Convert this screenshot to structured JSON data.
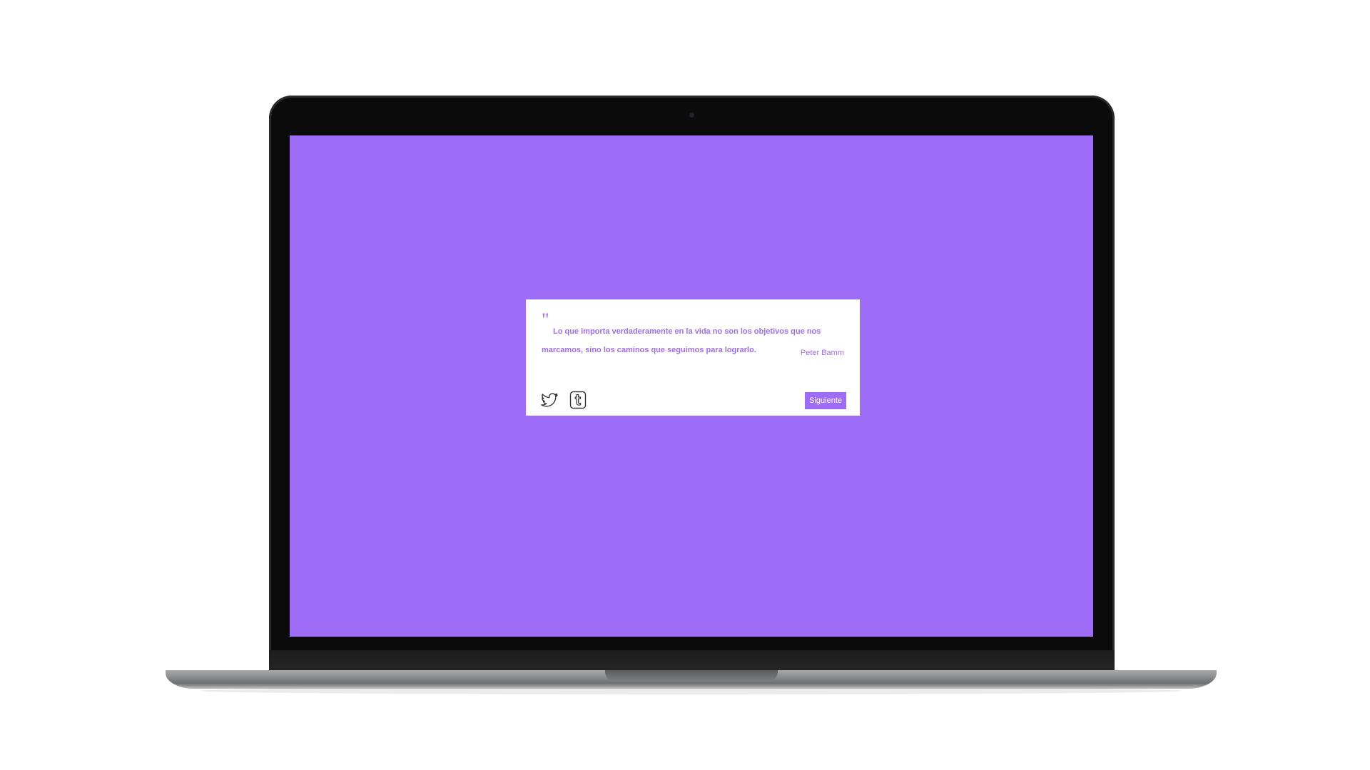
{
  "colors": {
    "accent": "#9f6cf8",
    "card_background": "#ffffff"
  },
  "quote": {
    "mark": "\"",
    "text": "Lo que importa verdaderamente en la vida no son los objetivos que nos marcamos, sino los caminos que seguimos para lograrlo.",
    "author": "Peter Bamm"
  },
  "share": {
    "twitter_icon": "twitter-bird-icon",
    "tumblr_icon": "tumblr-icon"
  },
  "actions": {
    "next_label": "Siguiente"
  }
}
